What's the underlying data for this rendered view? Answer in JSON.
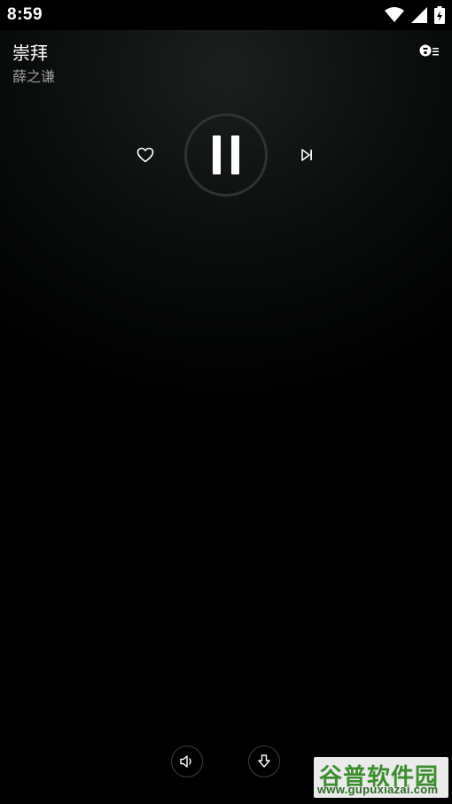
{
  "status_bar": {
    "time": "8:59",
    "icons": [
      "wifi-icon",
      "cell-signal-icon",
      "battery-charging-icon"
    ]
  },
  "song": {
    "title": "崇拜",
    "artist": "薛之谦"
  },
  "controls": {
    "like_icon": "heart-outline-icon",
    "play_state_icon": "pause-icon",
    "next_icon": "skip-next-icon",
    "playlist_icon": "playlist-icon"
  },
  "bottom": {
    "volume_icon": "volume-icon",
    "download_icon": "download-icon"
  },
  "watermark": {
    "name": "谷普软件园",
    "url": "www.gupuxiazai.com"
  },
  "colors": {
    "background": "#000000",
    "text_primary": "#ffffff",
    "text_secondary": "#9a9a9a",
    "ring": "#2e3332",
    "watermark_green": "#3c8d2f"
  }
}
